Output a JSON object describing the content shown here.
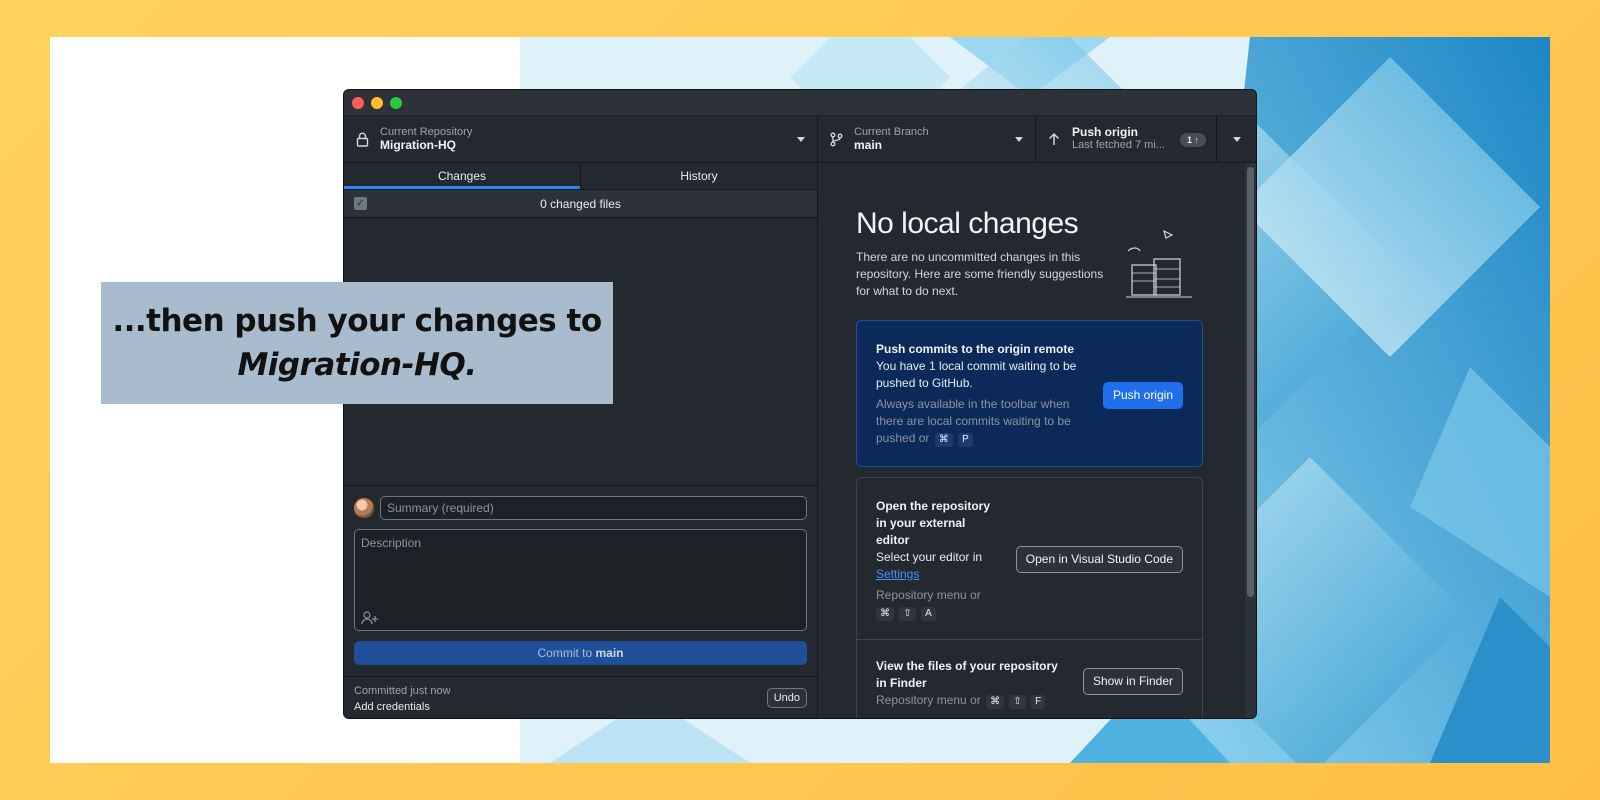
{
  "window": {
    "toolbar": {
      "repo": {
        "label": "Current Repository",
        "value": "Migration-HQ"
      },
      "branch": {
        "label": "Current Branch",
        "value": "main"
      },
      "push": {
        "label": "Push origin",
        "sub": "Last fetched 7 mi...",
        "badge": "1 ↑"
      }
    },
    "tabs": [
      "Changes",
      "History"
    ],
    "changes": {
      "count_label": "0 changed files"
    },
    "commit": {
      "summary_placeholder": "Summary (required)",
      "description_placeholder": "Description",
      "button_prefix": "Commit to ",
      "button_branch": "main"
    },
    "last_commit": {
      "time": "Committed just now",
      "note": "Add credentials",
      "undo": "Undo"
    },
    "no_changes": {
      "title": "No local changes",
      "description": "There are no uncommitted changes in this repository. Here are some friendly suggestions for what to do next."
    },
    "push_card": {
      "title": "Push commits to the origin remote",
      "text": "You have 1 local commit waiting to be pushed to GitHub.",
      "hint": "Always available in the toolbar when there are local commits waiting to be pushed or",
      "keys": [
        "⌘",
        "P"
      ],
      "button": "Push origin"
    },
    "editor_card": {
      "title": "Open the repository in your external editor",
      "text": "Select your editor in",
      "link": "Settings",
      "hint": "Repository menu or",
      "keys": [
        "⌘",
        "⇧",
        "A"
      ],
      "button": "Open in Visual Studio Code"
    },
    "finder_card": {
      "title": "View the files of your repository in Finder",
      "hint": "Repository menu or",
      "keys": [
        "⌘",
        "⇧",
        "F"
      ],
      "button": "Show in Finder"
    }
  },
  "caption": {
    "line1": "...then push your changes to",
    "line2": "Migration-HQ."
  },
  "colors": {
    "accent": "#1f6feb",
    "background": "#ffc84f",
    "caption_bg": "#a9bccd"
  }
}
